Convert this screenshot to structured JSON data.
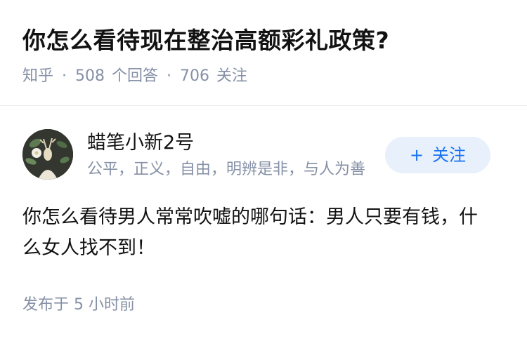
{
  "question": {
    "title": "你怎么看待现在整治高额彩礼政策?",
    "source": "知乎",
    "answer_count": "508",
    "answer_label": "个回答",
    "follow_count": "706",
    "follow_label": "关注"
  },
  "answer": {
    "author_name": "蜡笔小新2号",
    "author_bio": "公平，正义，自由，明辨是非，与人为善",
    "follow_button_label": "关注",
    "follow_button_icon": "plus-icon",
    "content": "你怎么看待男人常常吹嘘的哪句话：男人只要有钱，什么女人找不到！",
    "time_prefix": "发布于",
    "time_value": "5 小时前"
  },
  "colors": {
    "accent": "#1772f6",
    "button_bg": "#e7f0fb",
    "meta_text": "#8590a6",
    "primary_text": "#121212"
  }
}
